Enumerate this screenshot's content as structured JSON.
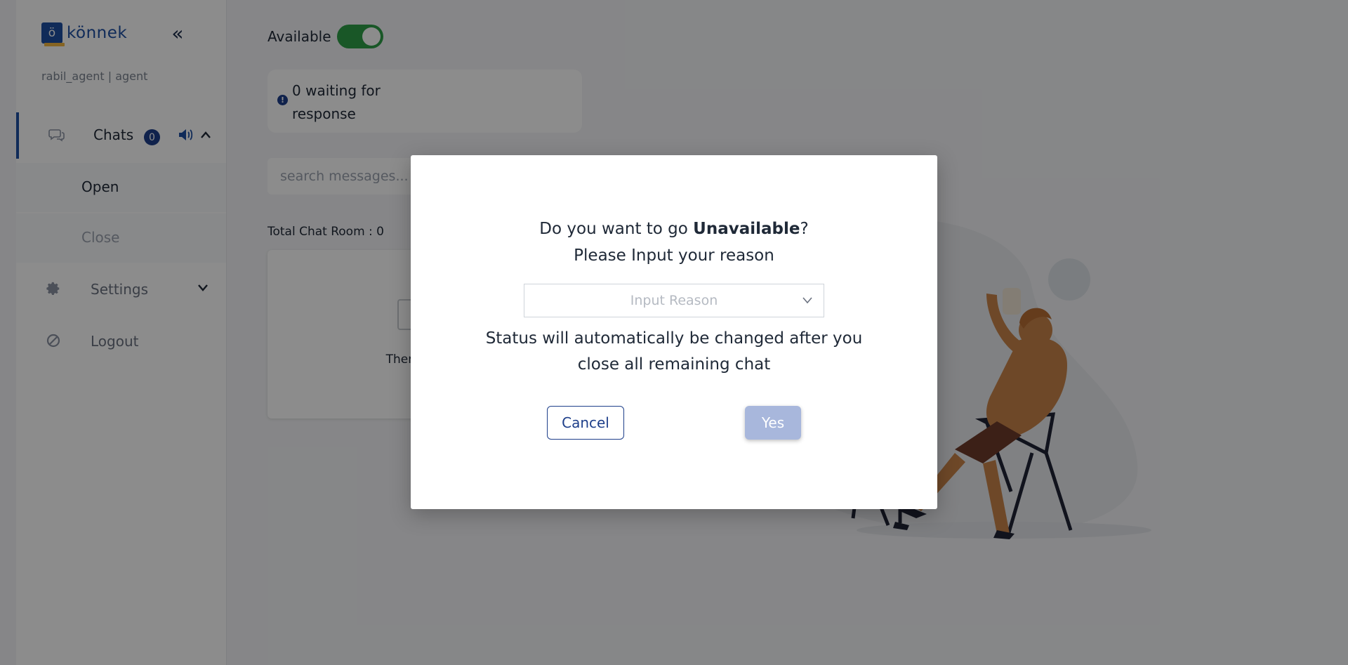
{
  "brand": {
    "logo_letter": "ö",
    "name": "könnek",
    "accent": "#1e4fa3"
  },
  "sidebar": {
    "user_line": "rabil_agent | agent",
    "collapse_glyph": "«",
    "chats": {
      "label": "Chats",
      "badge": "0"
    },
    "sub_items": [
      {
        "label": "Open"
      },
      {
        "label": "Close"
      }
    ],
    "settings": {
      "label": "Settings"
    },
    "logout": {
      "label": "Logout"
    }
  },
  "main": {
    "availability_label": "Available",
    "availability_on": true,
    "waiting_text": "0 waiting for response",
    "search_placeholder": "search messages...",
    "total_chat_room": "Total Chat Room : 0",
    "empty_message": "There's no m"
  },
  "modal": {
    "title_prefix": "Do you want to go ",
    "title_bold": "Unavailable",
    "title_suffix": "?",
    "subtitle": "Please Input your reason",
    "reason_placeholder": "Input Reason",
    "note_line1": "Status will automatically be changed after you",
    "note_line2": "close all remaining chat",
    "cancel_label": "Cancel",
    "yes_label": "Yes"
  },
  "colors": {
    "toggle_on": "#2e9e47",
    "badge": "#1e3f8a",
    "yes_button": "#a8b7dc"
  }
}
